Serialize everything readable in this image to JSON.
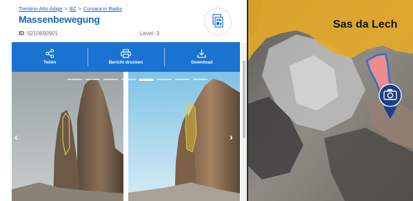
{
  "breadcrumb": {
    "items": [
      "Trentino-Alto Adige",
      "BZ",
      "Corvara in Badia"
    ],
    "separator": ">"
  },
  "title": "Massenbewegung",
  "meta": {
    "id_label": "ID",
    "id_value": "0210690901",
    "level_label": "Level:",
    "level_value": "3"
  },
  "report_icon": "report-document-icon",
  "actions": [
    {
      "label": "Teilen",
      "icon": "share-icon"
    },
    {
      "label": "Bericht drucken",
      "icon": "print-icon"
    },
    {
      "label": "Download",
      "icon": "download-icon"
    }
  ],
  "gallery": {
    "pages": 8,
    "active_page": 5,
    "prev_glyph": "‹",
    "next_glyph": "›"
  },
  "map": {
    "place_label": "Sas da Lech",
    "marker_icon": "camera-icon",
    "colors": {
      "hazard_zone": "#e3a92a",
      "slide_area": "#ec8c8c",
      "marker": "#1d3f86"
    }
  },
  "colors": {
    "accent": "#1a73d1",
    "title": "#1a66b6"
  }
}
